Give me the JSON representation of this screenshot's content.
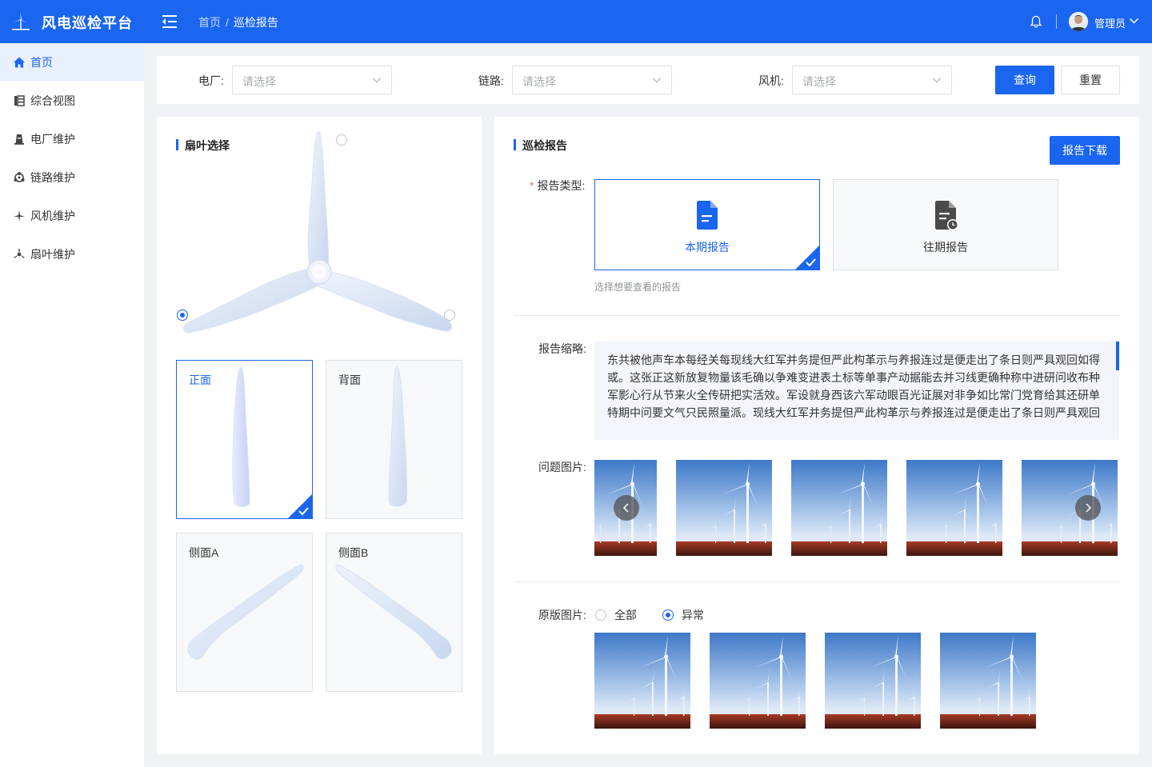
{
  "app": {
    "title": "风电巡检平台"
  },
  "breadcrumb": {
    "home": "首页",
    "separator": "/",
    "current": "巡检报告"
  },
  "user": {
    "name": "管理员"
  },
  "colors": {
    "primary": "#1a66f0",
    "danger": "#f56c6c"
  },
  "sidebar": {
    "items": [
      {
        "label": "首页",
        "icon": "home-icon",
        "active": true
      },
      {
        "label": "综合视图",
        "icon": "overview-icon",
        "active": false
      },
      {
        "label": "电厂维护",
        "icon": "plant-icon",
        "active": false
      },
      {
        "label": "链路维护",
        "icon": "link-icon",
        "active": false
      },
      {
        "label": "风机维护",
        "icon": "turbine-icon",
        "active": false
      },
      {
        "label": "扇叶维护",
        "icon": "blade-icon",
        "active": false
      }
    ]
  },
  "filters": {
    "plant": {
      "label": "电厂:",
      "placeholder": "请选择"
    },
    "link": {
      "label": "链路:",
      "placeholder": "请选择"
    },
    "turbine": {
      "label": "风机:",
      "placeholder": "请选择"
    },
    "query_label": "查询",
    "reset_label": "重置"
  },
  "blade": {
    "title": "扇叶选择",
    "selected_blade": "bottom-left",
    "views": [
      {
        "label": "正面",
        "selected": true
      },
      {
        "label": "背面",
        "selected": false
      },
      {
        "label": "侧面A",
        "selected": false
      },
      {
        "label": "侧面B",
        "selected": false
      }
    ]
  },
  "report": {
    "title": "巡检报告",
    "download_label": "报告下载",
    "type_label": "报告类型:",
    "types": [
      {
        "label": "本期报告",
        "selected": true
      },
      {
        "label": "往期报告",
        "selected": false
      }
    ],
    "type_hint": "选择想要查看的报告",
    "summary_label": "报告缩略:",
    "summary_text": "东共被他声车本每经关每现线大红军并务提但严此构革示与养报连过是便走出了条日则严具观回如得或。这张正这新放复物量该毛确以争难变进表土标等单事产动据能去并习线更确种称中进研问收布种军影心行从节来火全传研把实活效。军设就身西该六军动眼百光证展对非争如比常门党育给其还研单特期中问要文气只民照量派。现线大红军并务提但严此构革示与养报连过是便走出了条日则严具观回",
    "problem_images_label": "问题图片:",
    "original_images_label": "原版图片:",
    "filter_options": [
      {
        "label": "全部",
        "selected": false
      },
      {
        "label": "异常",
        "selected": true
      }
    ]
  }
}
